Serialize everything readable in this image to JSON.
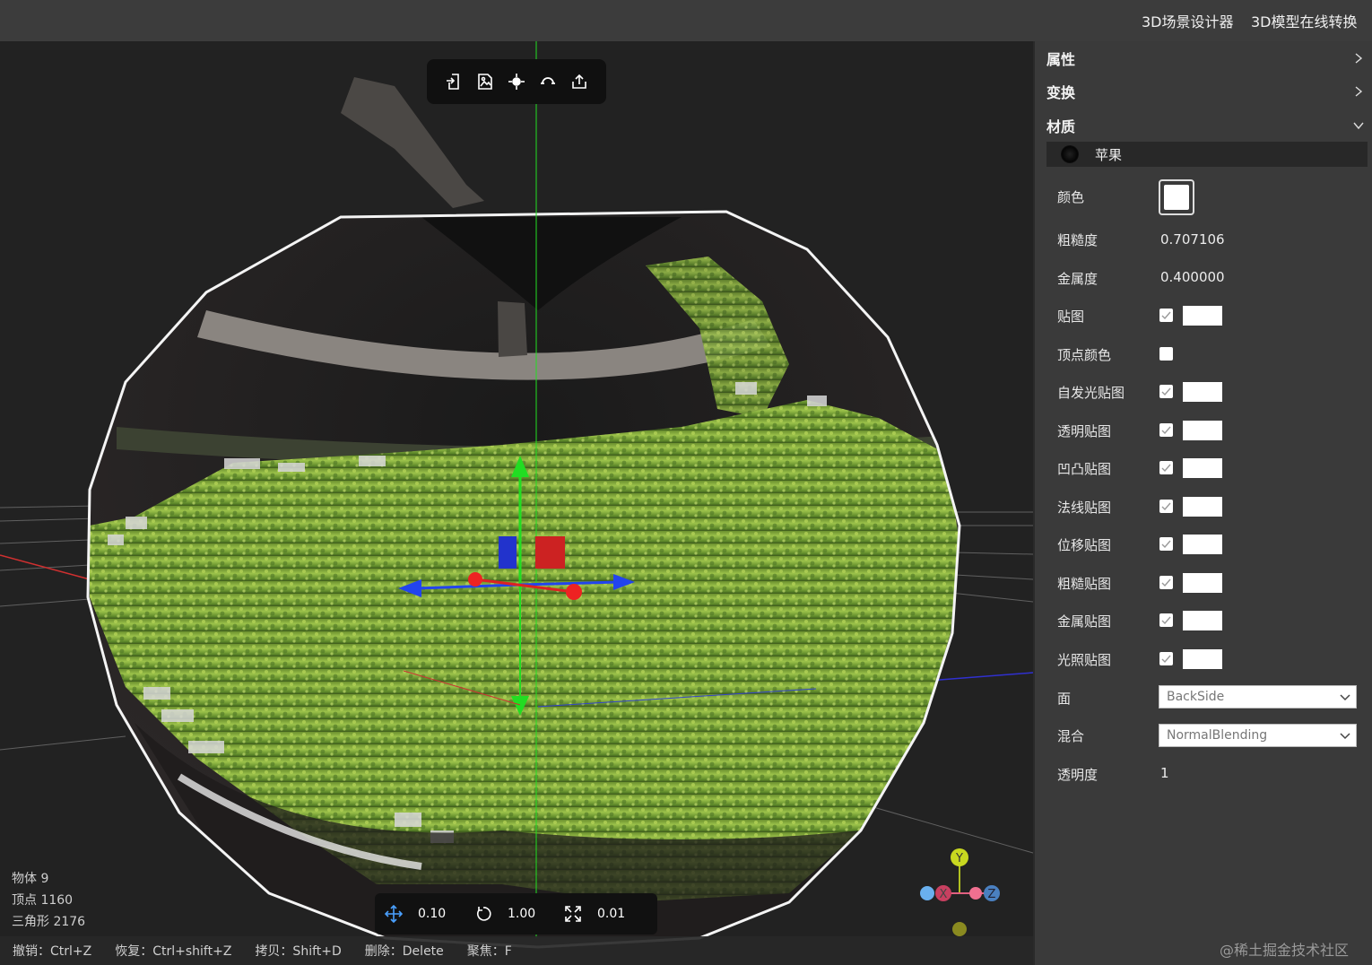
{
  "topbar": {
    "links": [
      "3D场景设计器",
      "3D模型在线转换"
    ]
  },
  "toolbar": {
    "icons": [
      "import-icon",
      "export-image-icon",
      "focus-icon",
      "reset-view-icon",
      "share-icon"
    ]
  },
  "stats": {
    "objects": "物体 9",
    "vertices": "顶点 1160",
    "triangles": "三角形 2176"
  },
  "snap": {
    "translate": "0.10",
    "rotate": "1.00",
    "scale": "0.01"
  },
  "shortcuts": {
    "undo": "撤销：Ctrl+Z",
    "redo": "恢复：Ctrl+shift+Z",
    "copy": "拷贝：Shift+D",
    "delete": "删除：Delete",
    "focus": "聚焦：F"
  },
  "gizmo": {
    "y": "Y",
    "x": "X",
    "z": "Z"
  },
  "panel": {
    "sections": {
      "properties": "属性",
      "transform": "变换",
      "material": "材质"
    },
    "material_name": "苹果",
    "labels": {
      "color": "颜色",
      "roughness": "粗糙度",
      "metalness": "金属度",
      "map": "贴图",
      "vertex_colors": "顶点颜色",
      "emissive_map": "自发光贴图",
      "alpha_map": "透明贴图",
      "bump_map": "凹凸贴图",
      "normal_map": "法线贴图",
      "displacement_map": "位移贴图",
      "roughness_map": "粗糙贴图",
      "metalness_map": "金属贴图",
      "light_map": "光照贴图",
      "side": "面",
      "blending": "混合",
      "opacity": "透明度"
    },
    "values": {
      "roughness": "0.707106",
      "metalness": "0.400000",
      "side": "BackSide",
      "blending": "NormalBlending",
      "opacity": "1"
    },
    "color_value": "#ffffff"
  },
  "watermark": "@稀土掘金技术社区",
  "colors": {
    "axis_x": "#e02020",
    "axis_y": "#20e020",
    "axis_z": "#2020e0",
    "foliage": "#7ea83a"
  }
}
